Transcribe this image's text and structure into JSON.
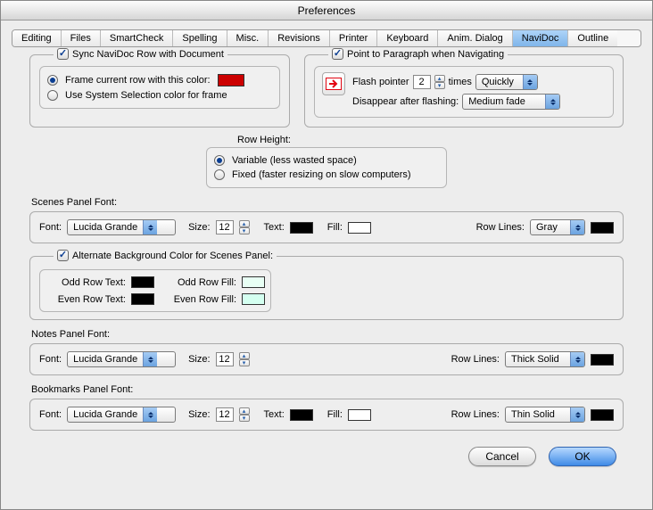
{
  "window": {
    "title": "Preferences"
  },
  "tabs": {
    "items": [
      "Editing",
      "Files",
      "SmartCheck",
      "Spelling",
      "Misc.",
      "Revisions",
      "Printer",
      "Keyboard",
      "Anim. Dialog",
      "NaviDoc",
      "Outline"
    ],
    "active_index": 9
  },
  "sync": {
    "title": "Sync NaviDoc Row with Document",
    "checked": true,
    "frame_option": "Frame current row with this color:",
    "frame_color": "#cc0000",
    "system_option": "Use System Selection color for frame",
    "selected": "frame"
  },
  "point": {
    "title": "Point to Paragraph when Navigating",
    "checked": true,
    "flash_label": "Flash pointer",
    "flash_count": "2",
    "times_label": "times",
    "times_value": "Quickly",
    "disappear_label": "Disappear after flashing:",
    "disappear_value": "Medium fade"
  },
  "row_height": {
    "label": "Row Height:",
    "variable": "Variable (less wasted space)",
    "fixed": "Fixed (faster resizing on slow computers)",
    "selected": "variable"
  },
  "scenes": {
    "label": "Scenes Panel Font:",
    "font_label": "Font:",
    "font_value": "Lucida Grande",
    "size_label": "Size:",
    "size_value": "12",
    "text_label": "Text:",
    "text_color": "#000000",
    "fill_label": "Fill:",
    "fill_color": "#ffffff",
    "rowlines_label": "Row Lines:",
    "rowlines_value": "Gray",
    "rowlines_color": "#000000"
  },
  "alt": {
    "checked": true,
    "title": "Alternate Background Color for Scenes Panel:",
    "odd_text_label": "Odd Row Text:",
    "odd_text_color": "#000000",
    "odd_fill_label": "Odd Row Fill:",
    "odd_fill_color": "#e8fff4",
    "even_text_label": "Even Row Text:",
    "even_text_color": "#000000",
    "even_fill_label": "Even Row Fill:",
    "even_fill_color": "#d4fff0"
  },
  "notes": {
    "label": "Notes Panel Font:",
    "font_label": "Font:",
    "font_value": "Lucida Grande",
    "size_label": "Size:",
    "size_value": "12",
    "rowlines_label": "Row Lines:",
    "rowlines_value": "Thick Solid",
    "rowlines_color": "#000000"
  },
  "bookmarks": {
    "label": "Bookmarks Panel Font:",
    "font_label": "Font:",
    "font_value": "Lucida Grande",
    "size_label": "Size:",
    "size_value": "12",
    "text_label": "Text:",
    "text_color": "#000000",
    "fill_label": "Fill:",
    "fill_color": "#ffffff",
    "rowlines_label": "Row Lines:",
    "rowlines_value": "Thin Solid",
    "rowlines_color": "#000000"
  },
  "buttons": {
    "cancel": "Cancel",
    "ok": "OK"
  }
}
